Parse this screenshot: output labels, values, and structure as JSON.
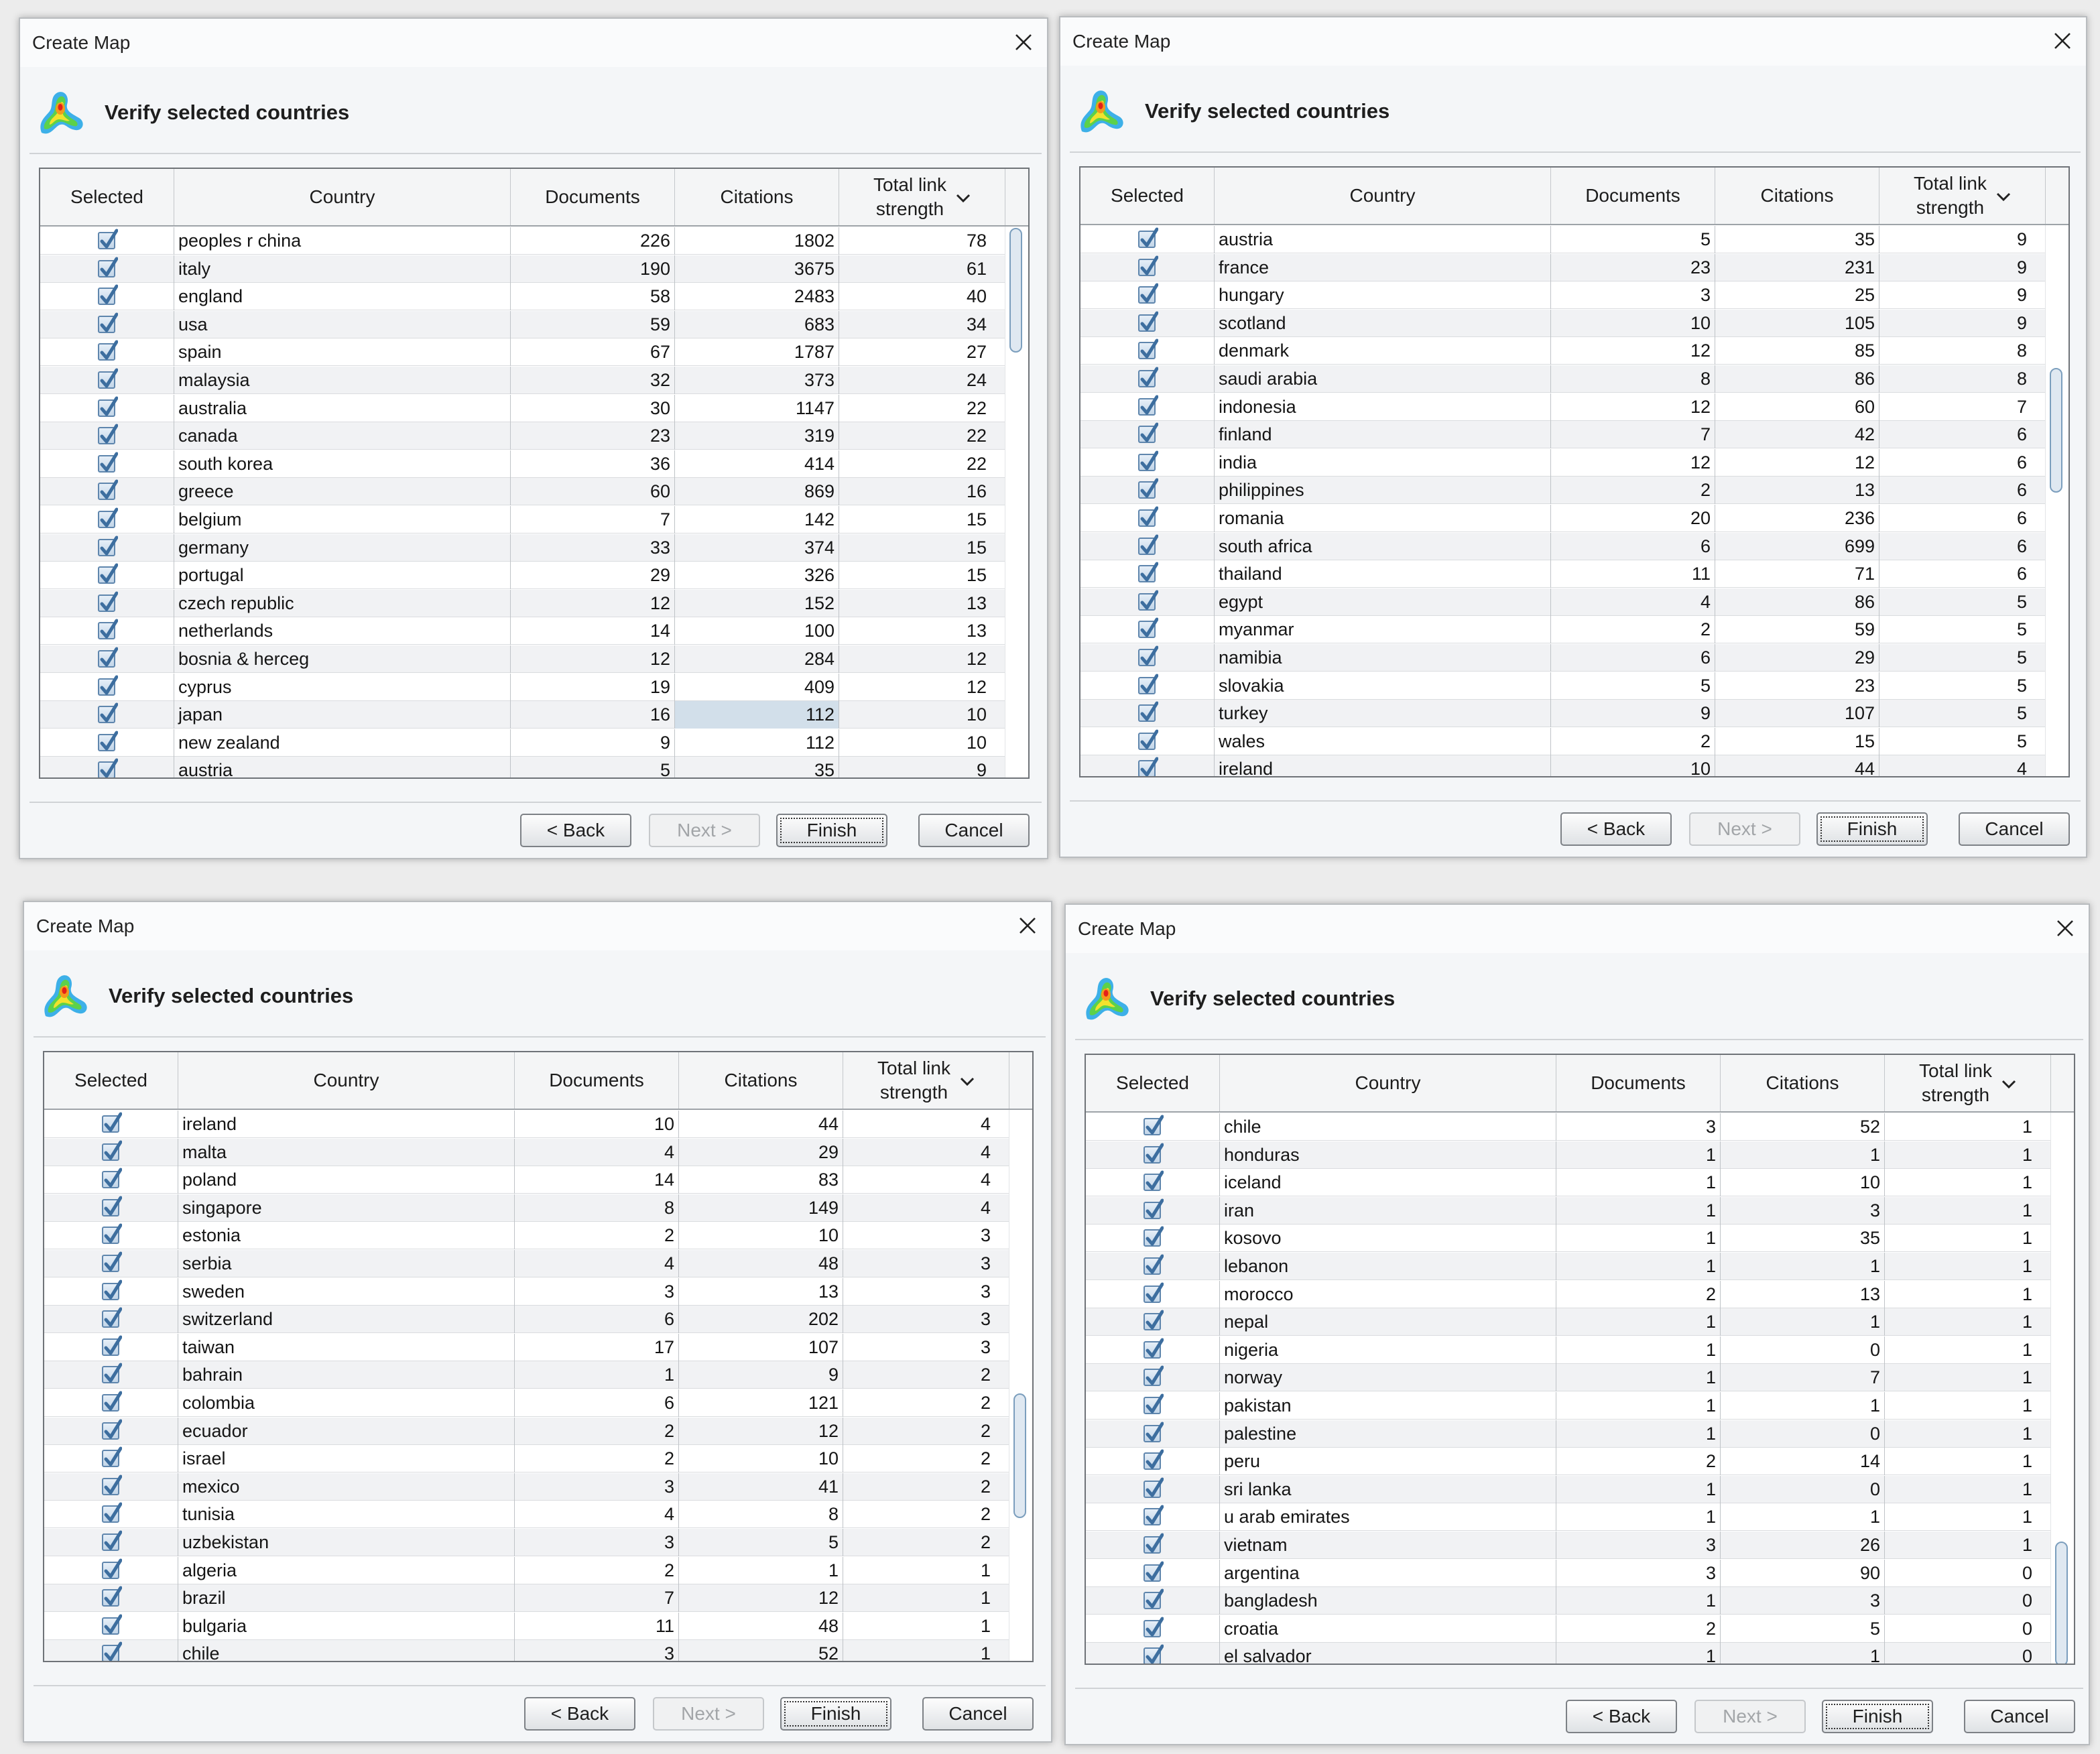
{
  "dialog": {
    "window_title": "Create Map",
    "heading": "Verify selected countries",
    "columns": {
      "selected": "Selected",
      "country": "Country",
      "documents": "Documents",
      "citations": "Citations",
      "total_link_strength": "Total link\nstrength"
    },
    "buttons": {
      "back": "< Back",
      "next": "Next >",
      "finish": "Finish",
      "cancel": "Cancel"
    }
  },
  "icons": {
    "close": "close-icon",
    "sort": "chevron-down-icon",
    "logo": "vosviewer-logo-icon",
    "checkbox": "checkbox-checked-icon"
  },
  "colors": {
    "header_bg": "#f4f5f6",
    "alt_row": "#f1f2f4",
    "checkbox": "#3d6e9f",
    "highlight_cell": "#d2dfea"
  },
  "panels": [
    {
      "scroll_fraction": 0.0,
      "highlight": {
        "row": 17,
        "column": "citations"
      },
      "rows": [
        {
          "country": "peoples r china",
          "documents": "226",
          "citations": "1802",
          "total_link_strength": "78"
        },
        {
          "country": "italy",
          "documents": "190",
          "citations": "3675",
          "total_link_strength": "61"
        },
        {
          "country": "england",
          "documents": "58",
          "citations": "2483",
          "total_link_strength": "40"
        },
        {
          "country": "usa",
          "documents": "59",
          "citations": "683",
          "total_link_strength": "34"
        },
        {
          "country": "spain",
          "documents": "67",
          "citations": "1787",
          "total_link_strength": "27"
        },
        {
          "country": "malaysia",
          "documents": "32",
          "citations": "373",
          "total_link_strength": "24"
        },
        {
          "country": "australia",
          "documents": "30",
          "citations": "1147",
          "total_link_strength": "22"
        },
        {
          "country": "canada",
          "documents": "23",
          "citations": "319",
          "total_link_strength": "22"
        },
        {
          "country": "south korea",
          "documents": "36",
          "citations": "414",
          "total_link_strength": "22"
        },
        {
          "country": "greece",
          "documents": "60",
          "citations": "869",
          "total_link_strength": "16"
        },
        {
          "country": "belgium",
          "documents": "7",
          "citations": "142",
          "total_link_strength": "15"
        },
        {
          "country": "germany",
          "documents": "33",
          "citations": "374",
          "total_link_strength": "15"
        },
        {
          "country": "portugal",
          "documents": "29",
          "citations": "326",
          "total_link_strength": "15"
        },
        {
          "country": "czech republic",
          "documents": "12",
          "citations": "152",
          "total_link_strength": "13"
        },
        {
          "country": "netherlands",
          "documents": "14",
          "citations": "100",
          "total_link_strength": "13"
        },
        {
          "country": "bosnia & herceg",
          "documents": "12",
          "citations": "284",
          "total_link_strength": "12"
        },
        {
          "country": "cyprus",
          "documents": "19",
          "citations": "409",
          "total_link_strength": "12"
        },
        {
          "country": "japan",
          "documents": "16",
          "citations": "112",
          "total_link_strength": "10"
        },
        {
          "country": "new zealand",
          "documents": "9",
          "citations": "112",
          "total_link_strength": "10"
        },
        {
          "country": "austria",
          "documents": "5",
          "citations": "35",
          "total_link_strength": "9"
        }
      ]
    },
    {
      "scroll_fraction": 0.33,
      "highlight": null,
      "rows": [
        {
          "country": "austria",
          "documents": "5",
          "citations": "35",
          "total_link_strength": "9"
        },
        {
          "country": "france",
          "documents": "23",
          "citations": "231",
          "total_link_strength": "9"
        },
        {
          "country": "hungary",
          "documents": "3",
          "citations": "25",
          "total_link_strength": "9"
        },
        {
          "country": "scotland",
          "documents": "10",
          "citations": "105",
          "total_link_strength": "9"
        },
        {
          "country": "denmark",
          "documents": "12",
          "citations": "85",
          "total_link_strength": "8"
        },
        {
          "country": "saudi arabia",
          "documents": "8",
          "citations": "86",
          "total_link_strength": "8"
        },
        {
          "country": "indonesia",
          "documents": "12",
          "citations": "60",
          "total_link_strength": "7"
        },
        {
          "country": "finland",
          "documents": "7",
          "citations": "42",
          "total_link_strength": "6"
        },
        {
          "country": "india",
          "documents": "12",
          "citations": "12",
          "total_link_strength": "6"
        },
        {
          "country": "philippines",
          "documents": "2",
          "citations": "13",
          "total_link_strength": "6"
        },
        {
          "country": "romania",
          "documents": "20",
          "citations": "236",
          "total_link_strength": "6"
        },
        {
          "country": "south africa",
          "documents": "6",
          "citations": "699",
          "total_link_strength": "6"
        },
        {
          "country": "thailand",
          "documents": "11",
          "citations": "71",
          "total_link_strength": "6"
        },
        {
          "country": "egypt",
          "documents": "4",
          "citations": "86",
          "total_link_strength": "5"
        },
        {
          "country": "myanmar",
          "documents": "2",
          "citations": "59",
          "total_link_strength": "5"
        },
        {
          "country": "namibia",
          "documents": "6",
          "citations": "29",
          "total_link_strength": "5"
        },
        {
          "country": "slovakia",
          "documents": "5",
          "citations": "23",
          "total_link_strength": "5"
        },
        {
          "country": "turkey",
          "documents": "9",
          "citations": "107",
          "total_link_strength": "5"
        },
        {
          "country": "wales",
          "documents": "2",
          "citations": "15",
          "total_link_strength": "5"
        },
        {
          "country": "ireland",
          "documents": "10",
          "citations": "44",
          "total_link_strength": "4"
        }
      ]
    },
    {
      "scroll_fraction": 0.66,
      "highlight": null,
      "rows": [
        {
          "country": "ireland",
          "documents": "10",
          "citations": "44",
          "total_link_strength": "4"
        },
        {
          "country": "malta",
          "documents": "4",
          "citations": "29",
          "total_link_strength": "4"
        },
        {
          "country": "poland",
          "documents": "14",
          "citations": "83",
          "total_link_strength": "4"
        },
        {
          "country": "singapore",
          "documents": "8",
          "citations": "149",
          "total_link_strength": "4"
        },
        {
          "country": "estonia",
          "documents": "2",
          "citations": "10",
          "total_link_strength": "3"
        },
        {
          "country": "serbia",
          "documents": "4",
          "citations": "48",
          "total_link_strength": "3"
        },
        {
          "country": "sweden",
          "documents": "3",
          "citations": "13",
          "total_link_strength": "3"
        },
        {
          "country": "switzerland",
          "documents": "6",
          "citations": "202",
          "total_link_strength": "3"
        },
        {
          "country": "taiwan",
          "documents": "17",
          "citations": "107",
          "total_link_strength": "3"
        },
        {
          "country": "bahrain",
          "documents": "1",
          "citations": "9",
          "total_link_strength": "2"
        },
        {
          "country": "colombia",
          "documents": "6",
          "citations": "121",
          "total_link_strength": "2"
        },
        {
          "country": "ecuador",
          "documents": "2",
          "citations": "12",
          "total_link_strength": "2"
        },
        {
          "country": "israel",
          "documents": "2",
          "citations": "10",
          "total_link_strength": "2"
        },
        {
          "country": "mexico",
          "documents": "3",
          "citations": "41",
          "total_link_strength": "2"
        },
        {
          "country": "tunisia",
          "documents": "4",
          "citations": "8",
          "total_link_strength": "2"
        },
        {
          "country": "uzbekistan",
          "documents": "3",
          "citations": "5",
          "total_link_strength": "2"
        },
        {
          "country": "algeria",
          "documents": "2",
          "citations": "1",
          "total_link_strength": "1"
        },
        {
          "country": "brazil",
          "documents": "7",
          "citations": "12",
          "total_link_strength": "1"
        },
        {
          "country": "bulgaria",
          "documents": "11",
          "citations": "48",
          "total_link_strength": "1"
        },
        {
          "country": "chile",
          "documents": "3",
          "citations": "52",
          "total_link_strength": "1"
        }
      ]
    },
    {
      "scroll_fraction": 1.0,
      "highlight": null,
      "rows": [
        {
          "country": "chile",
          "documents": "3",
          "citations": "52",
          "total_link_strength": "1"
        },
        {
          "country": "honduras",
          "documents": "1",
          "citations": "1",
          "total_link_strength": "1"
        },
        {
          "country": "iceland",
          "documents": "1",
          "citations": "10",
          "total_link_strength": "1"
        },
        {
          "country": "iran",
          "documents": "1",
          "citations": "3",
          "total_link_strength": "1"
        },
        {
          "country": "kosovo",
          "documents": "1",
          "citations": "35",
          "total_link_strength": "1"
        },
        {
          "country": "lebanon",
          "documents": "1",
          "citations": "1",
          "total_link_strength": "1"
        },
        {
          "country": "morocco",
          "documents": "2",
          "citations": "13",
          "total_link_strength": "1"
        },
        {
          "country": "nepal",
          "documents": "1",
          "citations": "1",
          "total_link_strength": "1"
        },
        {
          "country": "nigeria",
          "documents": "1",
          "citations": "0",
          "total_link_strength": "1"
        },
        {
          "country": "norway",
          "documents": "1",
          "citations": "7",
          "total_link_strength": "1"
        },
        {
          "country": "pakistan",
          "documents": "1",
          "citations": "1",
          "total_link_strength": "1"
        },
        {
          "country": "palestine",
          "documents": "1",
          "citations": "0",
          "total_link_strength": "1"
        },
        {
          "country": "peru",
          "documents": "2",
          "citations": "14",
          "total_link_strength": "1"
        },
        {
          "country": "sri lanka",
          "documents": "1",
          "citations": "0",
          "total_link_strength": "1"
        },
        {
          "country": "u arab emirates",
          "documents": "1",
          "citations": "1",
          "total_link_strength": "1"
        },
        {
          "country": "vietnam",
          "documents": "3",
          "citations": "26",
          "total_link_strength": "1"
        },
        {
          "country": "argentina",
          "documents": "3",
          "citations": "90",
          "total_link_strength": "0"
        },
        {
          "country": "bangladesh",
          "documents": "1",
          "citations": "3",
          "total_link_strength": "0"
        },
        {
          "country": "croatia",
          "documents": "2",
          "citations": "5",
          "total_link_strength": "0"
        },
        {
          "country": "el salvador",
          "documents": "1",
          "citations": "1",
          "total_link_strength": "0"
        }
      ]
    }
  ]
}
